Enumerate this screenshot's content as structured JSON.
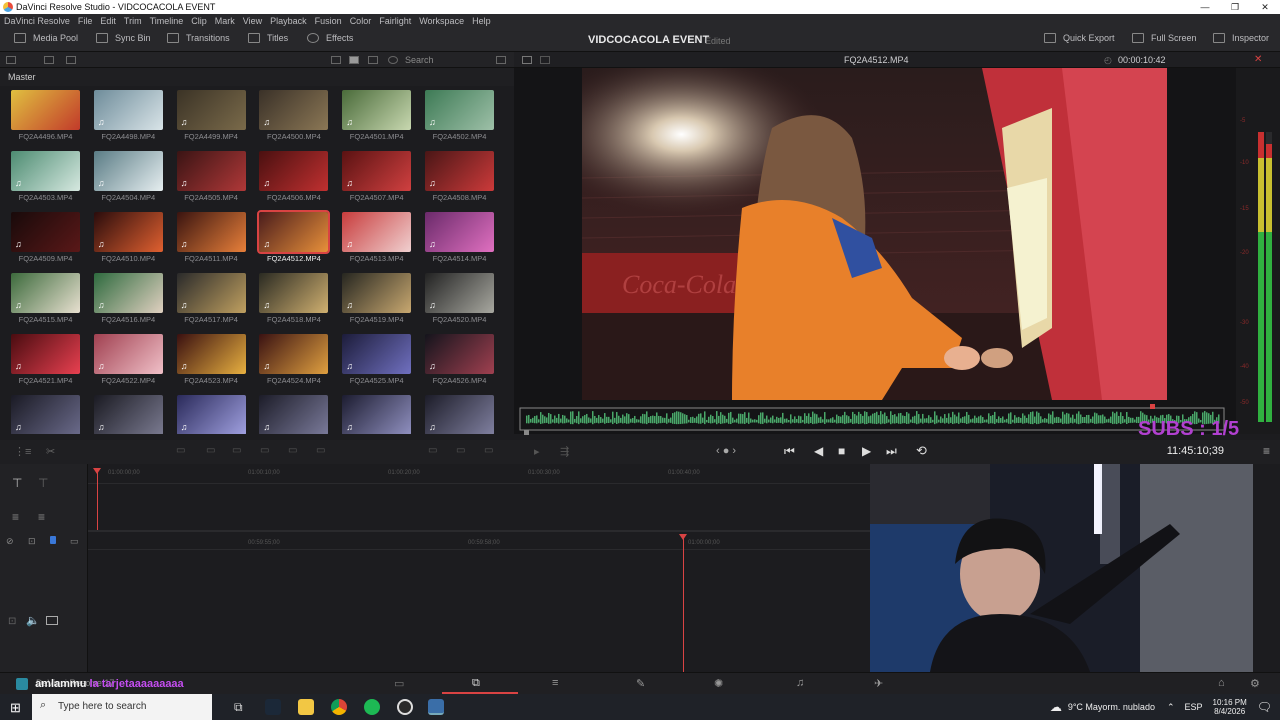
{
  "window": {
    "title": "DaVinci Resolve Studio - VIDCOCACOLA EVENT",
    "controls": [
      "—",
      "❐",
      "✕"
    ]
  },
  "menu": [
    "DaVinci Resolve",
    "File",
    "Edit",
    "Trim",
    "Timeline",
    "Clip",
    "Mark",
    "View",
    "Playback",
    "Fusion",
    "Color",
    "Fairlight",
    "Workspace",
    "Help"
  ],
  "toolbar": {
    "media_pool": "Media Pool",
    "sync_bin": "Sync Bin",
    "transitions": "Transitions",
    "titles": "Titles",
    "effects": "Effects",
    "project": "VIDCOCACOLA EVENT",
    "status": "Edited",
    "quick_export": "Quick Export",
    "full_screen": "Full Screen",
    "inspector": "Inspector"
  },
  "media_pool": {
    "search_placeholder": "Search",
    "bin": "Master",
    "clips": [
      {
        "name": "FQ2A4496.MP4",
        "c1": "#e0c040",
        "c2": "#c23a2a",
        "audio": false
      },
      {
        "name": "FQ2A4498.MP4",
        "c1": "#6e8c9a",
        "c2": "#d9e4e8",
        "audio": true
      },
      {
        "name": "FQ2A4499.MP4",
        "c1": "#3b3326",
        "c2": "#7a6a4a",
        "audio": true
      },
      {
        "name": "FQ2A4500.MP4",
        "c1": "#3a3128",
        "c2": "#8b7755",
        "audio": true
      },
      {
        "name": "FQ2A4501.MP4",
        "c1": "#4a6b3a",
        "c2": "#c8d8b0",
        "audio": true
      },
      {
        "name": "FQ2A4502.MP4",
        "c1": "#3d7a55",
        "c2": "#9ec0a8",
        "audio": true
      },
      {
        "name": "FQ2A4503.MP4",
        "c1": "#4d8c72",
        "c2": "#d6e8e0",
        "audio": true
      },
      {
        "name": "FQ2A4504.MP4",
        "c1": "#5a7c85",
        "c2": "#e6eef0",
        "audio": true
      },
      {
        "name": "FQ2A4505.MP4",
        "c1": "#3a1414",
        "c2": "#b03838",
        "audio": true
      },
      {
        "name": "FQ2A4506.MP4",
        "c1": "#4a1010",
        "c2": "#c03030",
        "audio": true
      },
      {
        "name": "FQ2A4507.MP4",
        "c1": "#5a1212",
        "c2": "#d04040",
        "audio": true
      },
      {
        "name": "FQ2A4508.MP4",
        "c1": "#4a1616",
        "c2": "#cc3a3a",
        "audio": true
      },
      {
        "name": "FQ2A4509.MP4",
        "c1": "#180a0a",
        "c2": "#5a1818",
        "audio": true
      },
      {
        "name": "FQ2A4510.MP4",
        "c1": "#2a0c0c",
        "c2": "#e06030",
        "audio": true
      },
      {
        "name": "FQ2A4511.MP4",
        "c1": "#3a1410",
        "c2": "#e8803a",
        "audio": true
      },
      {
        "name": "FQ2A4512.MP4",
        "c1": "#4a1c1c",
        "c2": "#e8903a",
        "audio": true,
        "selected": true
      },
      {
        "name": "FQ2A4513.MP4",
        "c1": "#c83c3c",
        "c2": "#f0d0d0",
        "audio": true
      },
      {
        "name": "FQ2A4514.MP4",
        "c1": "#6a2a6a",
        "c2": "#e070c0",
        "audio": true
      },
      {
        "name": "FQ2A4515.MP4",
        "c1": "#3c6a3c",
        "c2": "#e8e0d0",
        "audio": true
      },
      {
        "name": "FQ2A4516.MP4",
        "c1": "#2e6a3e",
        "c2": "#e0d0c0",
        "audio": true
      },
      {
        "name": "FQ2A4517.MP4",
        "c1": "#2a2a2a",
        "c2": "#c0a060",
        "audio": true
      },
      {
        "name": "FQ2A4518.MP4",
        "c1": "#2a2a22",
        "c2": "#d0b070",
        "audio": true
      },
      {
        "name": "FQ2A4519.MP4",
        "c1": "#262620",
        "c2": "#c8a870",
        "audio": true
      },
      {
        "name": "FQ2A4520.MP4",
        "c1": "#222222",
        "c2": "#a8a8a0",
        "audio": true
      },
      {
        "name": "FQ2A4521.MP4",
        "c1": "#4a0c10",
        "c2": "#e84050",
        "audio": true
      },
      {
        "name": "FQ2A4522.MP4",
        "c1": "#a04050",
        "c2": "#f0c0c8",
        "audio": true
      },
      {
        "name": "FQ2A4523.MP4",
        "c1": "#3a1010",
        "c2": "#e8b040",
        "audio": true
      },
      {
        "name": "FQ2A4524.MP4",
        "c1": "#3a1212",
        "c2": "#e0a040",
        "audio": true
      },
      {
        "name": "FQ2A4525.MP4",
        "c1": "#1c1c3a",
        "c2": "#7070c0",
        "audio": true
      },
      {
        "name": "FQ2A4526.MP4",
        "c1": "#14141c",
        "c2": "#a04050",
        "audio": true
      },
      {
        "name": "",
        "c1": "#1a1a24",
        "c2": "#6a6a8a",
        "audio": true
      },
      {
        "name": "",
        "c1": "#1a1a22",
        "c2": "#7a7a90",
        "audio": true
      },
      {
        "name": "",
        "c1": "#2a2a5a",
        "c2": "#a0a0e0",
        "audio": true
      },
      {
        "name": "",
        "c1": "#1c1c28",
        "c2": "#7a7a9a",
        "audio": true
      },
      {
        "name": "",
        "c1": "#1c1c30",
        "c2": "#9090c0",
        "audio": true
      },
      {
        "name": "",
        "c1": "#1c1c28",
        "c2": "#8080a0",
        "audio": true
      }
    ]
  },
  "viewer": {
    "clip_name": "FQ2A4512.MP4",
    "timecode": "00:00:10:42",
    "meter_labels": [
      "-5",
      "-10",
      "-15",
      "-20",
      "-30",
      "-40",
      "-50"
    ]
  },
  "transport": {
    "timecode": "11:45:10;39"
  },
  "timeline": {
    "ruler_top": [
      "01:00:00;00",
      "01:00:10;00",
      "01:00:20;00",
      "01:00:30;00",
      "01:00:40;00"
    ],
    "ruler_bottom": [
      "00:59:55;00",
      "00:59:58;00",
      "01:00:00;00"
    ]
  },
  "overlay": {
    "chat_user": "amlammu",
    "chat_msg": "la tarjetaaaaaaaaa",
    "subs": "SUBS : 1/5",
    "app_version": "DaVinci Resolve 17"
  },
  "taskbar": {
    "search_placeholder": "Type here to search",
    "weather": "9°C  Mayorm. nublado",
    "lang": "ESP",
    "time": "10:16 PM",
    "date": "8/4/2026"
  },
  "colors": {
    "accent": "#d94343",
    "waveform": "#4aa86a",
    "chat_msg": "#c44df0"
  }
}
